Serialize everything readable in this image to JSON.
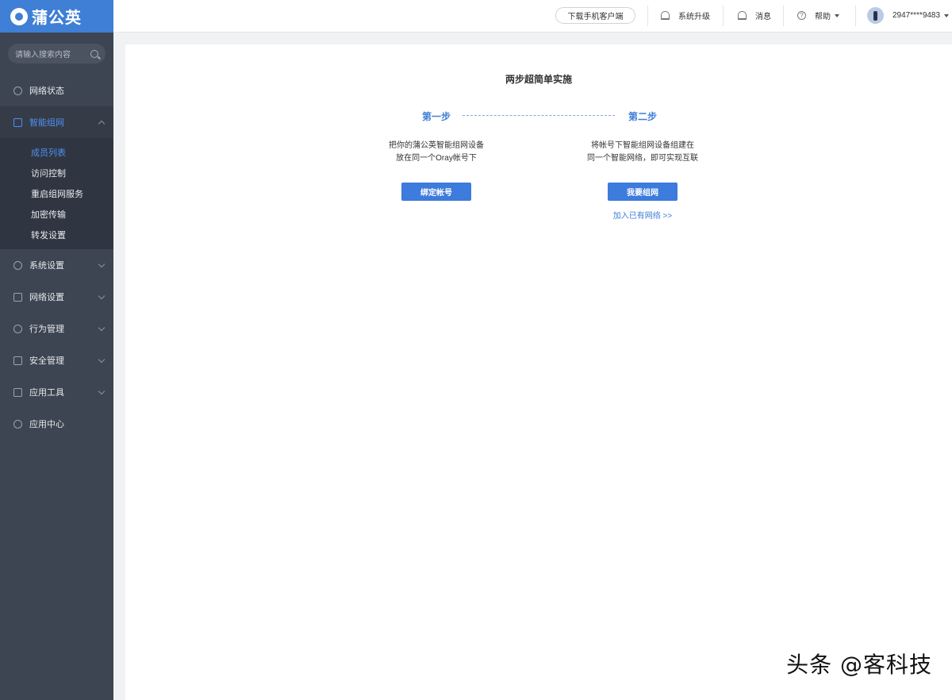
{
  "app": {
    "logo_text": "蒲公英"
  },
  "search": {
    "placeholder": "请输入搜索内容"
  },
  "sidebar": {
    "items": [
      {
        "label": "网络状态",
        "icon": "network-status-icon"
      },
      {
        "label": "智能组网",
        "icon": "smart-network-icon",
        "expanded": true
      },
      {
        "label": "系统设置",
        "icon": "system-settings-icon"
      },
      {
        "label": "网络设置",
        "icon": "network-settings-icon"
      },
      {
        "label": "行为管理",
        "icon": "behavior-management-icon"
      },
      {
        "label": "安全管理",
        "icon": "security-management-icon"
      },
      {
        "label": "应用工具",
        "icon": "app-tools-icon"
      },
      {
        "label": "应用中心",
        "icon": "app-center-icon"
      }
    ],
    "submenu": [
      {
        "label": "成员列表",
        "active": true
      },
      {
        "label": "访问控制"
      },
      {
        "label": "重启组网服务"
      },
      {
        "label": "加密传输"
      },
      {
        "label": "转发设置"
      }
    ]
  },
  "topbar": {
    "download_label": "下载手机客户端",
    "upgrade_label": "系统升级",
    "messages_label": "消息",
    "help_label": "帮助",
    "user_label": "2947****9483"
  },
  "main": {
    "title": "两步超简单实施",
    "step1": {
      "label": "第一步",
      "desc_line1": "把你的蒲公英智能组网设备",
      "desc_line2": "放在同一个Oray帐号下",
      "button": "绑定帐号"
    },
    "step2": {
      "label": "第二步",
      "desc_line1": "将帐号下智能组网设备组建在",
      "desc_line2": "同一个智能网络，即可实现互联",
      "button": "我要组网",
      "link": "加入已有网络 >>"
    }
  },
  "watermark": "头条 @客科技",
  "colors": {
    "accent": "#3f7fd6",
    "sidebar_bg": "#3d4552",
    "button_bg": "#3d7bdc"
  }
}
